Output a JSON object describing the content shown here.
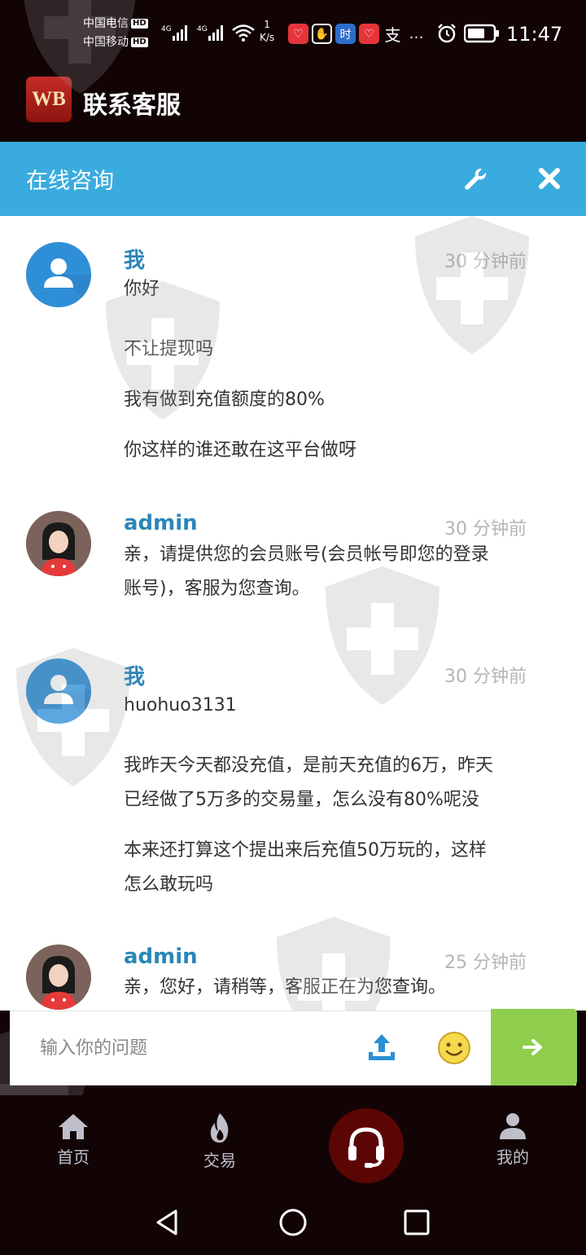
{
  "status_bar": {
    "carrier_1": "中国电信",
    "carrier_2": "中国移动",
    "hd_badge": "HD",
    "net_type": "4G",
    "net_speed_value": "1",
    "net_speed_unit": "K/s",
    "time": "11:47",
    "overflow": "…"
  },
  "app": {
    "logo_text": "WB",
    "title": "联系客服"
  },
  "consult": {
    "title": "在线咨询"
  },
  "messages": [
    {
      "sender": "我",
      "time": "30 分钟前",
      "avatar": "user-avatar",
      "lines": [
        "你好",
        "不让提现吗",
        "我有做到充值额度的80%",
        "你这样的谁还敢在这平台做呀"
      ]
    },
    {
      "sender": "admin",
      "time": "30 分钟前",
      "avatar": "admin-avatar",
      "lines": [
        "亲，请提供您的会员账号(会员帐号即您的登录",
        "账号)，客服为您查询。"
      ]
    },
    {
      "sender": "我",
      "time": "30 分钟前",
      "avatar": "user-avatar",
      "lines": [
        "huohuo3131",
        "我昨天今天都没充值，是前天充值的6万，昨天",
        "已经做了5万多的交易量，怎么没有80%呢没",
        "本来还打算这个提出来后充值50万玩的，这样",
        "怎么敢玩吗"
      ]
    },
    {
      "sender": "admin",
      "time": "25 分钟前",
      "avatar": "admin-avatar",
      "lines": [
        "亲，您好，请稍等，客服正在为您查询。"
      ]
    }
  ],
  "input": {
    "placeholder": "输入你的问题"
  },
  "nav": {
    "home": "首页",
    "trade": "交易",
    "mine": "我的"
  },
  "colors": {
    "consult_bar": "#3aabde",
    "sender_name": "#2b86b8",
    "send_button": "#8fce4d",
    "nav_center": "#5c0505",
    "background_dark": "#120405"
  }
}
